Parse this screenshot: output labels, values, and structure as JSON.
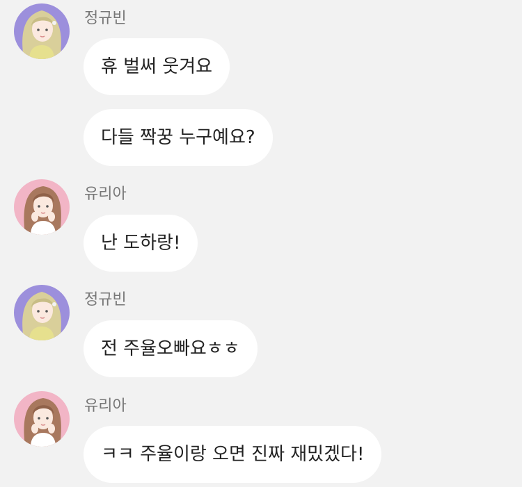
{
  "colors": {
    "background": "#f2f2f2",
    "bubble": "#ffffff",
    "sender_name": "#777777",
    "message_text": "#222222",
    "avatar_gyubin_bg": "#9c8fdc",
    "avatar_yuria_bg": "#f2b5c6"
  },
  "messages": [
    {
      "sender": "정규빈",
      "avatar_icon": "avatar-gyubin-icon",
      "bubbles": [
        "휴 벌써 웃겨요",
        "다들 짝꿍 누구예요?"
      ]
    },
    {
      "sender": "유리아",
      "avatar_icon": "avatar-yuria-icon",
      "bubbles": [
        "난 도하랑!"
      ]
    },
    {
      "sender": "정규빈",
      "avatar_icon": "avatar-gyubin-icon",
      "bubbles": [
        "전 주율오빠요ㅎㅎ"
      ]
    },
    {
      "sender": "유리아",
      "avatar_icon": "avatar-yuria-icon",
      "bubbles": [
        "ㅋㅋ 주율이랑 오면 진짜 재밌겠다!"
      ]
    }
  ]
}
